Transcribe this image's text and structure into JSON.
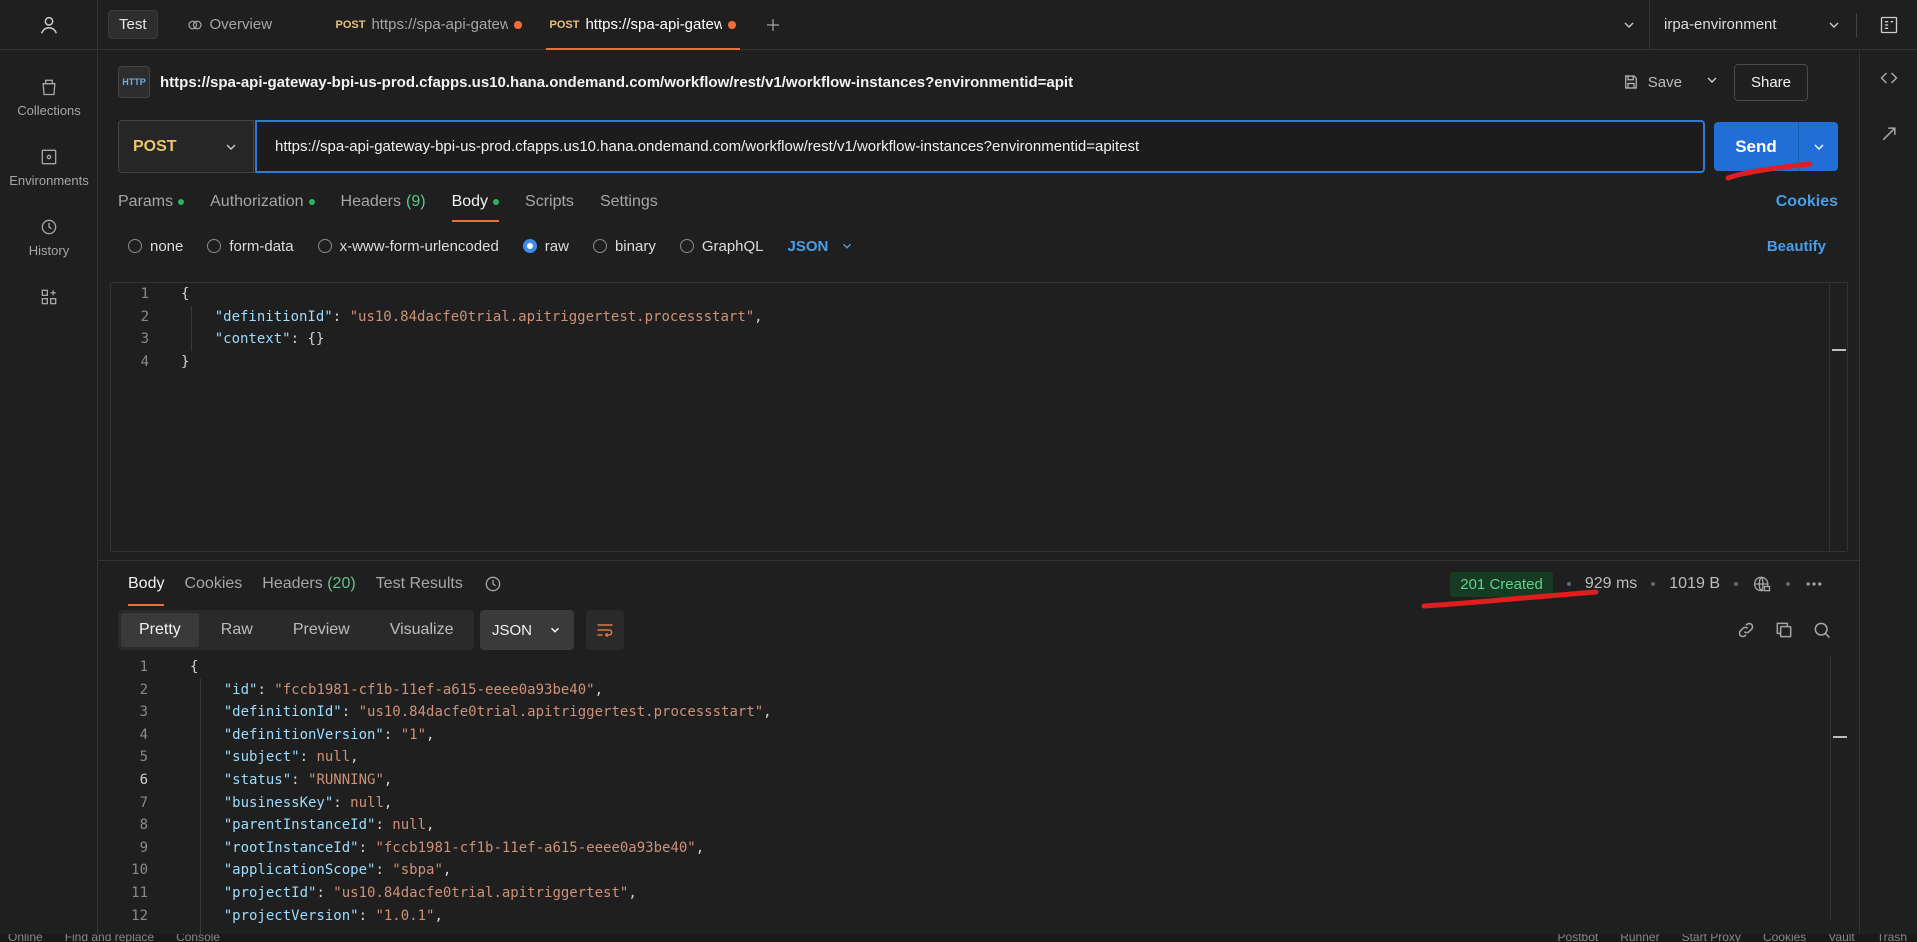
{
  "sidebar": {
    "items": [
      {
        "label": "Collections",
        "icon": "collections-icon"
      },
      {
        "label": "Environments",
        "icon": "environments-icon"
      },
      {
        "label": "History",
        "icon": "history-icon"
      },
      {
        "label": "",
        "icon": "add-widgets-icon"
      }
    ]
  },
  "tabs": {
    "items": [
      {
        "label": "Test",
        "type": "workspace"
      },
      {
        "label": "Overview",
        "type": "overview"
      },
      {
        "method": "POST",
        "label": "https://spa-api-gatewa",
        "unsaved": true
      },
      {
        "method": "POST",
        "label": "https://spa-api-gatewa",
        "unsaved": true,
        "active": true
      }
    ],
    "environment": "irpa-environment"
  },
  "request": {
    "name": "https://spa-api-gateway-bpi-us-prod.cfapps.us10.hana.ondemand.com/workflow/rest/v1/workflow-instances?environmentid=apit",
    "http_badge": "HTTP",
    "save_label": "Save",
    "share_label": "Share",
    "method": "POST",
    "url": "https://spa-api-gateway-bpi-us-prod.cfapps.us10.hana.ondemand.com/workflow/rest/v1/workflow-instances?environmentid=apitest",
    "send_label": "Send",
    "tabs": [
      {
        "label": "Params",
        "dot": true
      },
      {
        "label": "Authorization",
        "dot": true
      },
      {
        "label": "Headers",
        "count": "(9)"
      },
      {
        "label": "Body",
        "dot": true,
        "active": true
      },
      {
        "label": "Scripts"
      },
      {
        "label": "Settings"
      }
    ],
    "cookies_label": "Cookies",
    "body_types": [
      "none",
      "form-data",
      "x-www-form-urlencoded",
      "raw",
      "binary",
      "GraphQL"
    ],
    "body_type_selected": "raw",
    "body_format": "JSON",
    "beautify_label": "Beautify",
    "body_lines": [
      {
        "n": "1",
        "t": "{"
      },
      {
        "n": "2",
        "t": "    \"definitionId\": \"us10.84dacfe0trial.apitriggertest.processstart\","
      },
      {
        "n": "3",
        "t": "    \"context\": {}"
      },
      {
        "n": "4",
        "t": "}"
      }
    ]
  },
  "response": {
    "tabs": [
      {
        "label": "Body",
        "active": true
      },
      {
        "label": "Cookies"
      },
      {
        "label": "Headers",
        "count": "(20)"
      },
      {
        "label": "Test Results"
      }
    ],
    "status": "201 Created",
    "time": "929 ms",
    "size": "1019 B",
    "view_modes": [
      "Pretty",
      "Raw",
      "Preview",
      "Visualize"
    ],
    "view_mode_selected": "Pretty",
    "format": "JSON",
    "lines": [
      {
        "n": "1",
        "t": "{"
      },
      {
        "n": "2",
        "k": "id",
        "v": "\"fccb1981-cf1b-11ef-a615-eeee0a93be40\""
      },
      {
        "n": "3",
        "k": "definitionId",
        "v": "\"us10.84dacfe0trial.apitriggertest.processstart\""
      },
      {
        "n": "4",
        "k": "definitionVersion",
        "v": "\"1\""
      },
      {
        "n": "5",
        "k": "subject",
        "v": "null"
      },
      {
        "n": "6",
        "k": "status",
        "v": "\"RUNNING\""
      },
      {
        "n": "7",
        "k": "businessKey",
        "v": "null"
      },
      {
        "n": "8",
        "k": "parentInstanceId",
        "v": "null"
      },
      {
        "n": "9",
        "k": "rootInstanceId",
        "v": "\"fccb1981-cf1b-11ef-a615-eeee0a93be40\""
      },
      {
        "n": "10",
        "k": "applicationScope",
        "v": "\"sbpa\""
      },
      {
        "n": "11",
        "k": "projectId",
        "v": "\"us10.84dacfe0trial.apitriggertest\""
      },
      {
        "n": "12",
        "k": "projectVersion",
        "v": "\"1.0.1\""
      }
    ]
  },
  "statusbar": {
    "left": [
      "Online",
      "Find and replace",
      "Console"
    ],
    "right": [
      "Postbot",
      "Runner",
      "Start Proxy",
      "Cookies",
      "Vault",
      "Trash"
    ]
  },
  "colors": {
    "accent_blue": "#1f6fd6",
    "tab_indicator": "#f26b3a",
    "status_green": "#5fd38a",
    "annotation_red": "#e01e1e"
  }
}
